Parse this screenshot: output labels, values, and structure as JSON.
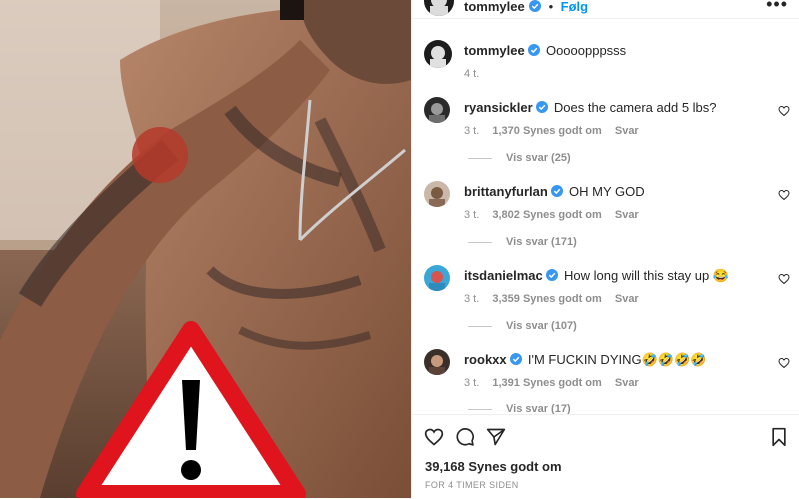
{
  "header": {
    "username": "tommylee",
    "separator": "•",
    "follow_label": "Følg",
    "more_glyph": "•••"
  },
  "caption": {
    "username": "tommylee",
    "text": "Ooooopppsss",
    "time": "4 t."
  },
  "comments": [
    {
      "username": "ryansickler",
      "verified": true,
      "text": "Does the camera add 5 lbs?",
      "time": "3 t.",
      "likes": "1,370 Synes godt om",
      "reply": "Svar",
      "view_replies": "Vis svar (25)"
    },
    {
      "username": "brittanyfurlan",
      "verified": true,
      "text": "OH MY GOD",
      "time": "3 t.",
      "likes": "3,802 Synes godt om",
      "reply": "Svar",
      "view_replies": "Vis svar (171)"
    },
    {
      "username": "itsdanielmac",
      "verified": true,
      "text": "How long will this stay up 😂",
      "time": "3 t.",
      "likes": "3,359 Synes godt om",
      "reply": "Svar",
      "view_replies": "Vis svar (107)"
    },
    {
      "username": "rookxx",
      "verified": true,
      "text": "I'M FUCKIN DYING🤣🤣🤣🤣",
      "time": "3 t.",
      "likes": "1,391 Synes godt om",
      "reply": "Svar",
      "view_replies": "Vis svar (17)"
    }
  ],
  "footer": {
    "likes": "39,168 Synes godt om",
    "time_ago": "FOR 4 TIMER SIDEN"
  },
  "icons": {
    "like": "heart-outline-icon",
    "comment": "comment-bubble-icon",
    "share": "paper-plane-icon",
    "save": "bookmark-icon",
    "warning": "warning-triangle-icon",
    "verified": "verified-badge-icon"
  },
  "colors": {
    "link_blue": "#0095f6",
    "verified_blue": "#3897f0",
    "muted_text": "#8e8e8e",
    "warning_red": "#e0141c"
  }
}
